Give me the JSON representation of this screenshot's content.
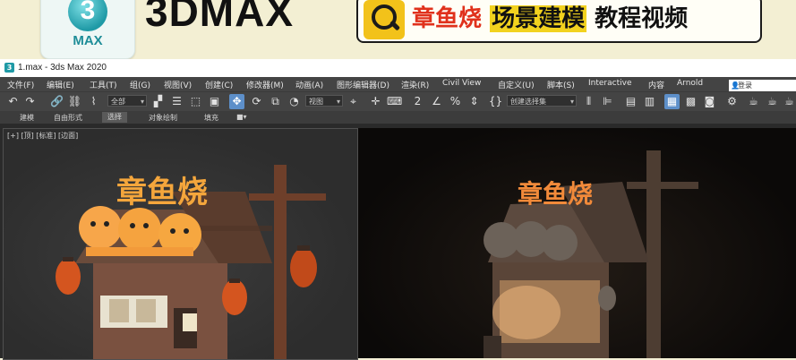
{
  "banner": {
    "logo_glyph": "3",
    "logo_text": "MAX",
    "brand": "3DMAX",
    "title_red": "章鱼烧",
    "title_black": "场景建模",
    "title_tail": "教程视频",
    "icon": "search-icon"
  },
  "window": {
    "title": "1.max - 3ds Max 2020",
    "app_icon_glyph": "3"
  },
  "menu": [
    "文件(F)",
    "编辑(E)",
    "工具(T)",
    "组(G)",
    "视图(V)",
    "创建(C)",
    "修改器(M)",
    "动画(A)",
    "图形编辑器(D)",
    "渲染(R)",
    "Civil View",
    "自定义(U)",
    "脚本(S)",
    "Interactive",
    "内容",
    "Arnold"
  ],
  "toolbar": {
    "selection_filter": "全部",
    "reference_coord": "视图",
    "named_selection": "创建选择集",
    "search_placeholder": "登录"
  },
  "ribbon_tabs": [
    "建模",
    "自由形式",
    "选择",
    "对象绘制",
    "填充"
  ],
  "ribbon_selected": "选择",
  "viewport_left_label": "[+] [顶] [标准] [边面]",
  "scene": {
    "sign_left": "章鱼烧",
    "sign_right": "章鱼烧"
  },
  "colors": {
    "banner_bg": "#f3efd3",
    "title_red": "#e0311c",
    "highlight_yellow": "#f2d21e",
    "ui_dark": "#444444",
    "active_blue": "#5d8fc9"
  }
}
